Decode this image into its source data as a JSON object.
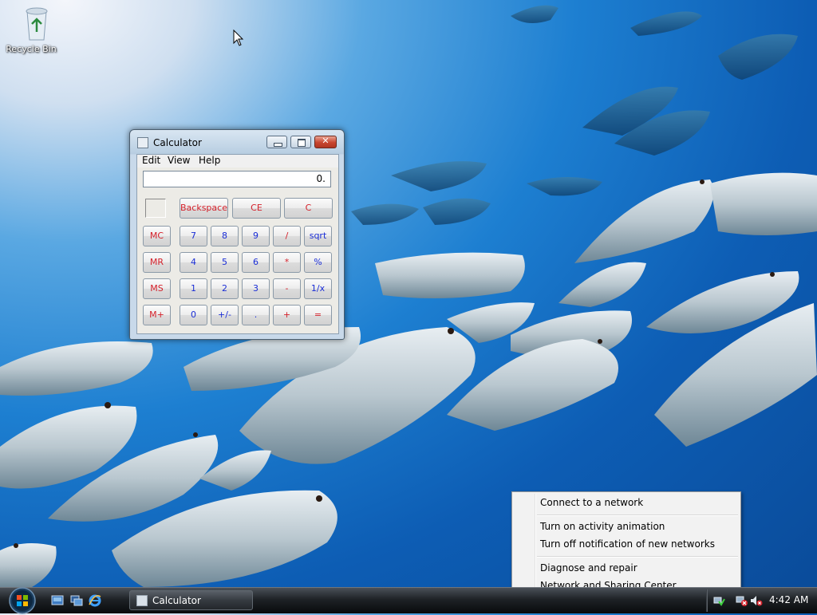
{
  "desktop": {
    "icons": [
      {
        "label": "Recycle Bin",
        "icon": "recycle-bin-icon"
      }
    ]
  },
  "calculator": {
    "title": "Calculator",
    "menu": [
      "Edit",
      "View",
      "Help"
    ],
    "display": "0.",
    "top_buttons": [
      "Backspace",
      "CE",
      "C"
    ],
    "memory_buttons": [
      "MC",
      "MR",
      "MS",
      "M+"
    ],
    "rows": [
      [
        "7",
        "8",
        "9",
        "/",
        "sqrt"
      ],
      [
        "4",
        "5",
        "6",
        "*",
        "%"
      ],
      [
        "1",
        "2",
        "3",
        "-",
        "1/x"
      ],
      [
        "0",
        "+/-",
        ".",
        "+",
        "="
      ]
    ],
    "colors": {
      "digit": "#1a2dd6",
      "operator": "#d4202a"
    }
  },
  "context_menu": {
    "items": [
      "Connect to a network",
      "Turn on activity animation",
      "Turn off notification of new networks",
      "Diagnose and repair",
      "Network and Sharing Center"
    ]
  },
  "taskbar": {
    "start_icon": "windows-orb-icon",
    "quick_launch": [
      "show-desktop-icon",
      "switch-windows-icon",
      "internet-explorer-icon"
    ],
    "task_buttons": [
      {
        "label": "Calculator",
        "icon": "calculator-icon"
      }
    ],
    "tray_icons": [
      "network-connected-icon",
      "network-disconnected-icon",
      "volume-muted-icon"
    ],
    "clock": "4:42 AM"
  }
}
